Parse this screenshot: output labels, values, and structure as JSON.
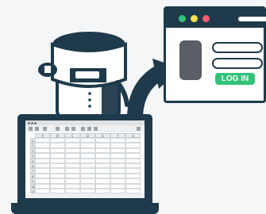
{
  "browser": {
    "login_label": "LOG IN"
  },
  "spreadsheet": {
    "columns": [
      "A",
      "B",
      "C",
      "D",
      "E",
      "F",
      "G"
    ],
    "rows": [
      "1",
      "2",
      "3",
      "4",
      "5",
      "6",
      "7",
      "8",
      "9",
      "10",
      "11"
    ]
  },
  "colors": {
    "dark": "#1f3a4a",
    "green": "#32c37a",
    "yellow": "#ffe15a",
    "red": "#f15b74"
  }
}
